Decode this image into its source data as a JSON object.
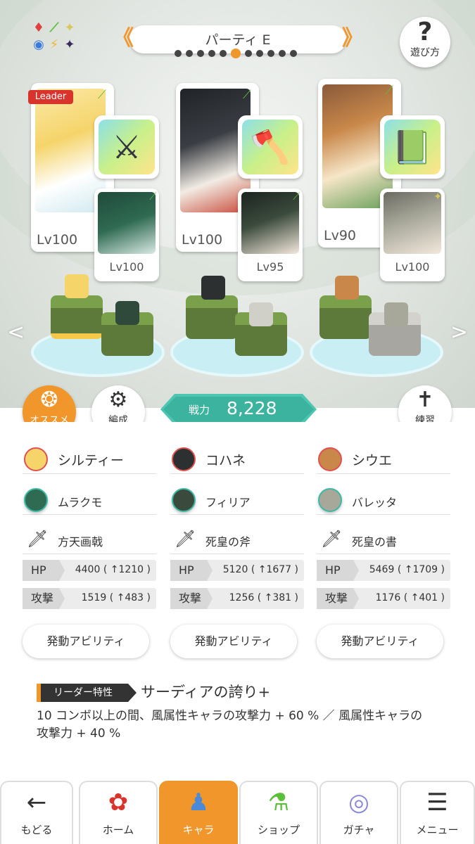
{
  "header": {
    "party_name": "パーティ E",
    "page_count": 11,
    "active_page_index": 5,
    "help_label": "遊び方",
    "element_icons": [
      "♦",
      "⟋",
      "✦",
      "◉",
      "⚡",
      "✦"
    ]
  },
  "cards": [
    {
      "level": "Lv100",
      "leader_badge": "Leader",
      "weapon_icon": "spear-icon",
      "sub": {
        "level": "Lv100"
      }
    },
    {
      "level": "Lv100",
      "weapon_icon": "axe-icon",
      "sub": {
        "level": "Lv95"
      }
    },
    {
      "level": "Lv90",
      "weapon_icon": "book-icon",
      "sub": {
        "level": "Lv100"
      }
    }
  ],
  "controls": {
    "recommend_label": "オススメ",
    "formation_label": "編成",
    "practice_label": "練習",
    "power_label": "戦力",
    "power_value": "8,228"
  },
  "members": [
    {
      "main": "シルティー",
      "sub": "ムラクモ",
      "weapon": "方天画戟",
      "hp_label": "HP",
      "hp": "4400 ( ↑1210 )",
      "atk_label": "攻撃",
      "atk": "1519 ( ↑483 )",
      "ability_label": "発動アビリティ"
    },
    {
      "main": "コハネ",
      "sub": "フィリア",
      "weapon": "死皇の斧",
      "hp_label": "HP",
      "hp": "5120 ( ↑1677 )",
      "atk_label": "攻撃",
      "atk": "1256 ( ↑381 )",
      "ability_label": "発動アビリティ"
    },
    {
      "main": "シウエ",
      "sub": "バレッタ",
      "weapon": "死皇の書",
      "hp_label": "HP",
      "hp": "5469 ( ↑1709 )",
      "atk_label": "攻撃",
      "atk": "1176 ( ↑401 )",
      "ability_label": "発動アビリティ"
    }
  ],
  "leader_skill": {
    "tag": "リーダー特性",
    "name": "サーディアの誇り+",
    "description": "10 コンボ以上の間、風属性キャラの攻撃力 + 60 % ／ 風属性キャラの攻撃力 + 40 %"
  },
  "nav": {
    "back": "もどる",
    "home": "ホーム",
    "chara": "キャラ",
    "shop": "ショップ",
    "gacha": "ガチャ",
    "menu": "メニュー"
  },
  "colors": {
    "accent": "#f0962a",
    "teal": "#3bb39e",
    "leader_red": "#d8342c",
    "wind_green": "#5cbf3a"
  }
}
